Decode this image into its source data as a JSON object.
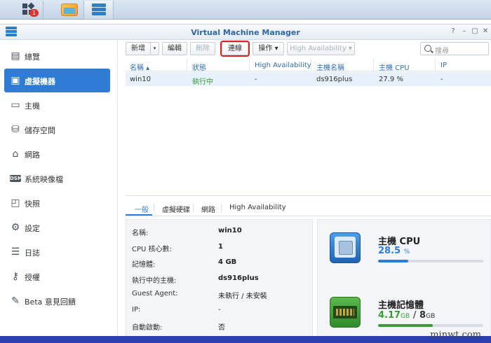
{
  "taskbar": {
    "notification_count": "1",
    "items": [
      "main-menu",
      "file-station",
      "virtual-machine-manager"
    ]
  },
  "window": {
    "title": "Virtual Machine Manager",
    "controls": [
      "?",
      "–",
      "▢",
      "✕"
    ]
  },
  "sidebar": {
    "items": [
      {
        "label": "總覽",
        "icon": "overview-icon"
      },
      {
        "label": "虛擬機器",
        "icon": "virtual-machine-icon",
        "active": true
      },
      {
        "label": "主機",
        "icon": "host-icon"
      },
      {
        "label": "儲存空間",
        "icon": "storage-icon"
      },
      {
        "label": "網路",
        "icon": "network-icon"
      },
      {
        "label": "系統映像檔",
        "icon": "image-icon"
      },
      {
        "label": "快照",
        "icon": "snapshot-icon"
      },
      {
        "label": "設定",
        "icon": "gear-icon"
      },
      {
        "label": "日誌",
        "icon": "log-icon"
      },
      {
        "label": "授權",
        "icon": "license-icon"
      },
      {
        "label": "Beta 意見回饋",
        "icon": "feedback-icon"
      }
    ]
  },
  "toolbar": {
    "create": "新增",
    "edit": "編輯",
    "delete": "刪除",
    "connect": "連線",
    "action": "操作 ▾",
    "ha": "High Availability ▾",
    "search_placeholder": "搜尋"
  },
  "grid": {
    "columns": [
      "名稱 ▴",
      "狀態",
      "High Availability",
      "主機名稱",
      "主機 CPU",
      "IP"
    ],
    "rows": [
      {
        "name": "win10",
        "status": "執行中",
        "ha": "-",
        "host": "ds916plus",
        "cpu": "27.9 %",
        "ip": "-"
      }
    ]
  },
  "detail_tabs": [
    "一般",
    "虛擬硬碟",
    "網路",
    "High Availability"
  ],
  "info": [
    {
      "label": "名稱:",
      "value": "win10"
    },
    {
      "label": "CPU 核心數:",
      "value": "1"
    },
    {
      "label": "記憶體:",
      "value": "4 GB"
    },
    {
      "label": "執行中的主機:",
      "value": "ds916plus"
    },
    {
      "label": "Guest Agent:",
      "value": "未執行 / 未安裝"
    },
    {
      "label": "IP:",
      "value": "-"
    },
    {
      "label": "自動啟動:",
      "value": "否"
    }
  ],
  "resources": {
    "cpu": {
      "title": "主機 CPU",
      "value": "28.5",
      "unit": "%",
      "percent": 28.5,
      "color": "#2e7cd6"
    },
    "memory": {
      "title": "主機記憶體",
      "used": "4.17",
      "used_unit": "GB",
      "sep": "/",
      "total": "8",
      "total_unit": "GB",
      "fraction": 0.52,
      "color": "#3a9c35"
    }
  },
  "watermark": "minwt.com"
}
